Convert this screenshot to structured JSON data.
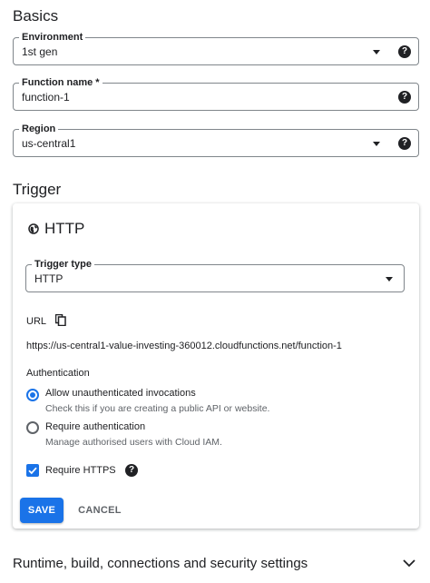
{
  "basics": {
    "title": "Basics",
    "environment": {
      "label": "Environment",
      "value": "1st gen"
    },
    "function_name": {
      "label": "Function name *",
      "value": "function-1"
    },
    "region": {
      "label": "Region",
      "value": "us-central1"
    }
  },
  "trigger": {
    "title": "Trigger",
    "card": {
      "heading": "HTTP",
      "trigger_type": {
        "label": "Trigger type",
        "value": "HTTP"
      },
      "url_label": "URL",
      "url": "https://us-central1-value-investing-360012.cloudfunctions.net/function-1",
      "authentication": {
        "heading": "Authentication",
        "options": [
          {
            "label": "Allow unauthenticated invocations",
            "hint": "Check this if you are creating a public API or website.",
            "selected": true
          },
          {
            "label": "Require authentication",
            "hint": "Manage authorised users with Cloud IAM.",
            "selected": false
          }
        ]
      },
      "require_https": {
        "label": "Require HTTPS",
        "checked": true
      },
      "save_label": "SAVE",
      "cancel_label": "CANCEL"
    }
  },
  "advanced": {
    "title": "Runtime, build, connections and security settings"
  },
  "colors": {
    "accent": "#1a73e8",
    "text": "#202124",
    "secondary": "#5f6368"
  },
  "icons": [
    "caret-down-icon",
    "help-icon",
    "globe-icon",
    "copy-icon",
    "check-icon",
    "chevron-down-icon"
  ]
}
